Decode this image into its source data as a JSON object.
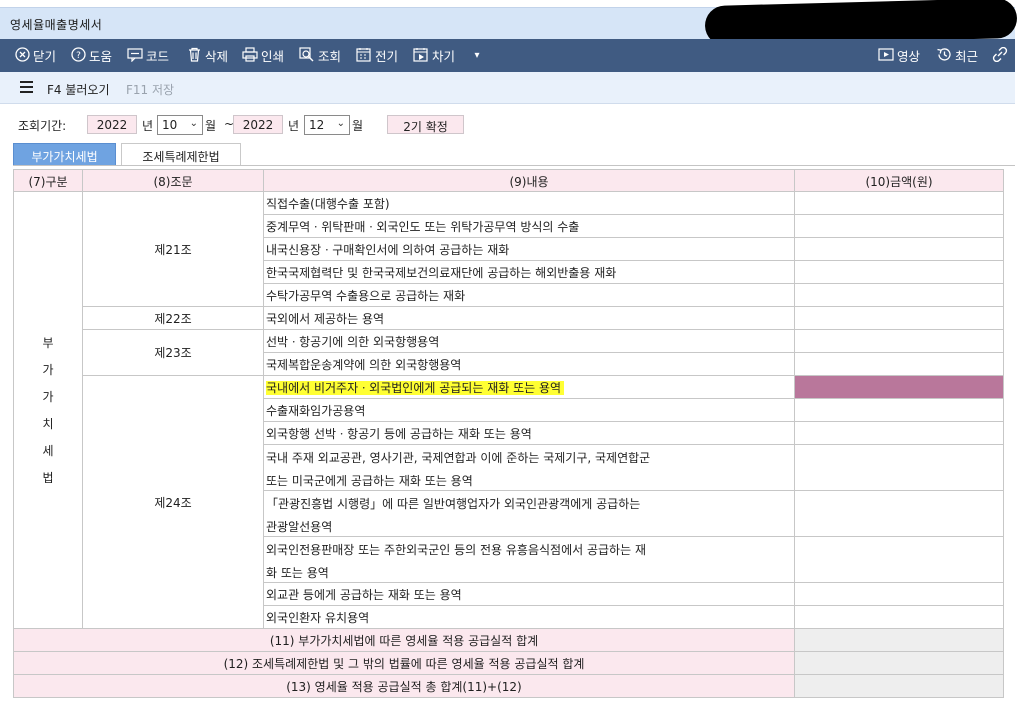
{
  "window": {
    "title": "영세율매출명세서"
  },
  "toolbar": {
    "items": [
      {
        "label": "닫기",
        "icon": "close-icon"
      },
      {
        "label": "도움",
        "icon": "help-icon"
      },
      {
        "label": "코드",
        "icon": "code-icon"
      },
      {
        "label": "삭제",
        "icon": "delete-icon"
      },
      {
        "label": "인쇄",
        "icon": "print-icon"
      },
      {
        "label": "조회",
        "icon": "search-icon"
      },
      {
        "label": "전기",
        "icon": "transfer-icon"
      },
      {
        "label": "차기",
        "icon": "next-icon"
      }
    ],
    "right": [
      {
        "label": "영상",
        "icon": "video-icon"
      },
      {
        "label": "최근",
        "icon": "recent-icon"
      }
    ]
  },
  "commands": {
    "f4": "F4 불러오기",
    "f11": "F11 저장"
  },
  "filter": {
    "label": "조회기간:",
    "from_year": "2022",
    "from_month": "10",
    "to_year": "2022",
    "to_month": "12",
    "year_unit": "년",
    "month_unit": "월",
    "tilde": "~",
    "confirm": "2기 확정"
  },
  "tabs": [
    "부가가치세법",
    "조세특례제한법"
  ],
  "table": {
    "headers": [
      "(7)구분",
      "(8)조문",
      "(9)내용",
      "(10)금액(원)"
    ],
    "category": "부가가치세법",
    "category_chars": [
      "부",
      "가",
      "가",
      "치",
      "세",
      "법"
    ],
    "articles": [
      "제21조",
      "제22조",
      "제23조",
      "제24조"
    ],
    "items": [
      "직접수출(대행수출 포함)",
      "중계무역ㆍ위탁판매ㆍ외국인도 또는 위탁가공무역 방식의 수출",
      "내국신용장ㆍ구매확인서에 의하여 공급하는 재화",
      "한국국제협력단 및 한국국제보건의료재단에 공급하는 해외반출용 재화",
      "수탁가공무역 수출용으로 공급하는 재화",
      "국외에서 제공하는 용역",
      "선박ㆍ항공기에 의한 외국항행용역",
      "국제복합운송계약에 의한 외국항행용역",
      "국내에서 비거주자ㆍ외국법인에게 공급되는 재화 또는 용역",
      "수출재화임가공용역",
      "외국항행 선박ㆍ항공기 등에 공급하는 재화 또는 용역",
      "국내 주재 외교공관, 영사기관, 국제연합과 이에 준하는 국제기구, 국제연합군\n또는 미국군에게 공급하는 재화 또는 용역",
      "「관광진흥법 시행령」에 따른 일반여행업자가 외국인관광객에게 공급하는\n관광알선용역",
      "외국인전용판매장 또는 주한외국군인 등의 전용 유흥음식점에서 공급하는 재\n화 또는 용역",
      "외교관 등에게 공급하는 재화 또는 용역",
      "외국인환자 유치용역"
    ],
    "highlighted_item": 8,
    "highlight_color": "#b9779b",
    "marker_color": "#ffff33",
    "amounts": [
      "",
      "",
      "",
      "",
      "",
      "",
      "",
      "",
      "",
      "",
      "",
      "",
      "",
      "",
      "",
      ""
    ],
    "totals": [
      {
        "label": "(11) 부가가치세법에 따른 영세율 적용 공급실적 합계",
        "amount": ""
      },
      {
        "label": "(12) 조세특례제한법 및 그 밖의 법률에 따른 영세율 적용 공급실적 합계",
        "amount": ""
      },
      {
        "label": "(13) 영세율 적용 공급실적 총 합계(11)+(12)",
        "amount": ""
      }
    ]
  }
}
